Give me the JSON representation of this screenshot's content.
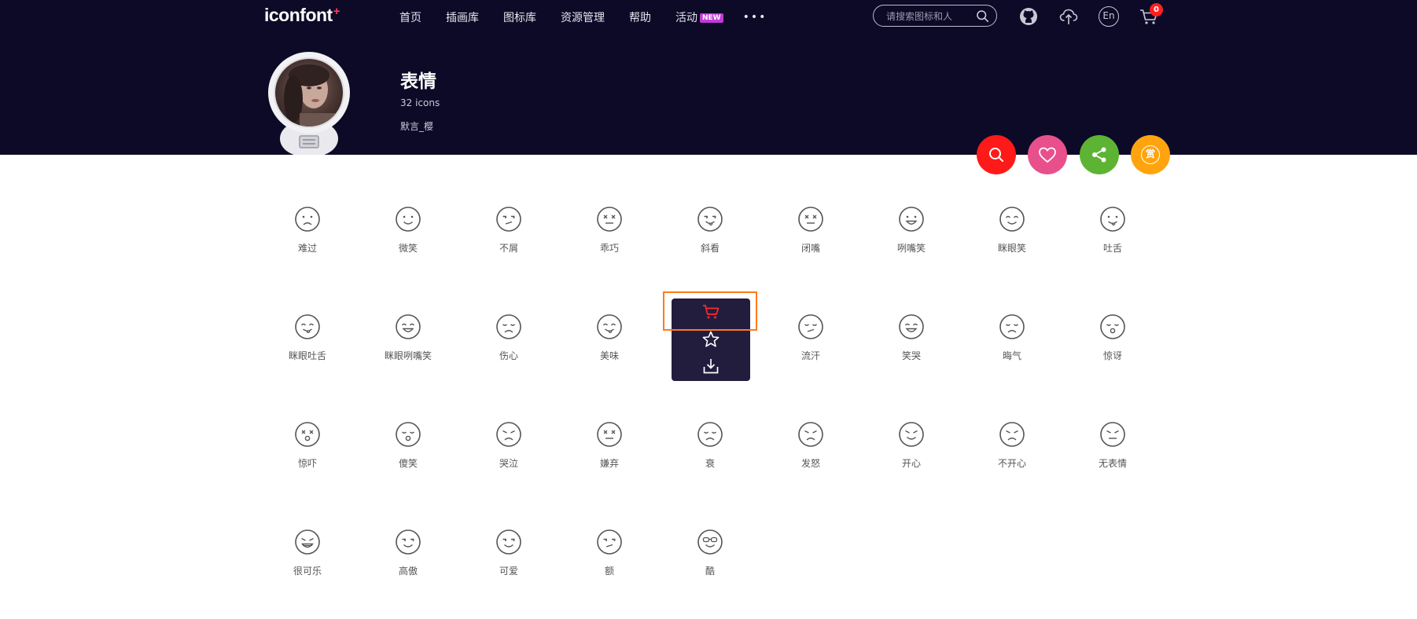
{
  "header": {
    "logo_text": "iconfont",
    "logo_plus": "+",
    "nav": [
      {
        "label": "首页"
      },
      {
        "label": "插画库"
      },
      {
        "label": "图标库"
      },
      {
        "label": "资源管理"
      },
      {
        "label": "帮助"
      },
      {
        "label": "活动",
        "badge": "NEW"
      }
    ],
    "more_label": "•••",
    "search_placeholder": "请搜索图标和人",
    "icons": [
      "github-icon",
      "upload-icon",
      "language-en-icon",
      "cart-icon"
    ],
    "language_label": "En",
    "cart_count": "0"
  },
  "album": {
    "title": "表情",
    "count": "32 icons",
    "author": "默言_樱"
  },
  "actions": [
    {
      "name": "search-action",
      "color": "#ff1a1a"
    },
    {
      "name": "favorite-action",
      "color": "#e8508c"
    },
    {
      "name": "share-action",
      "color": "#5db434"
    },
    {
      "name": "reward-action",
      "color": "#ffa40e",
      "label": "赏"
    }
  ],
  "icons": [
    {
      "label": "难过"
    },
    {
      "label": "微笑"
    },
    {
      "label": "不屑"
    },
    {
      "label": "乖巧"
    },
    {
      "label": "斜看"
    },
    {
      "label": "闭嘴"
    },
    {
      "label": "咧嘴笑"
    },
    {
      "label": "眯眼笑"
    },
    {
      "label": "吐舌"
    },
    {
      "label": "眯眼吐舌"
    },
    {
      "label": "眯眼咧嘴笑"
    },
    {
      "label": "伤心"
    },
    {
      "label": "美味"
    },
    {
      "label": ""
    },
    {
      "label": "流汗"
    },
    {
      "label": "笑哭"
    },
    {
      "label": "晦气"
    },
    {
      "label": "惊讶"
    },
    {
      "label": "惊吓"
    },
    {
      "label": "傻笑"
    },
    {
      "label": "哭泣"
    },
    {
      "label": "嫌弃"
    },
    {
      "label": "衰"
    },
    {
      "label": "发怒"
    },
    {
      "label": "开心"
    },
    {
      "label": "不开心"
    },
    {
      "label": "无表情"
    },
    {
      "label": "很可乐"
    },
    {
      "label": "高傲"
    },
    {
      "label": "可爱"
    },
    {
      "label": "额"
    },
    {
      "label": "酷"
    }
  ],
  "hover_menu": {
    "items": [
      "cart-icon",
      "star-icon",
      "download-icon"
    ],
    "cart_color": "#ff2a2a"
  },
  "colors": {
    "header_bg": "#0c0a26",
    "icon_stroke": "#555555"
  }
}
